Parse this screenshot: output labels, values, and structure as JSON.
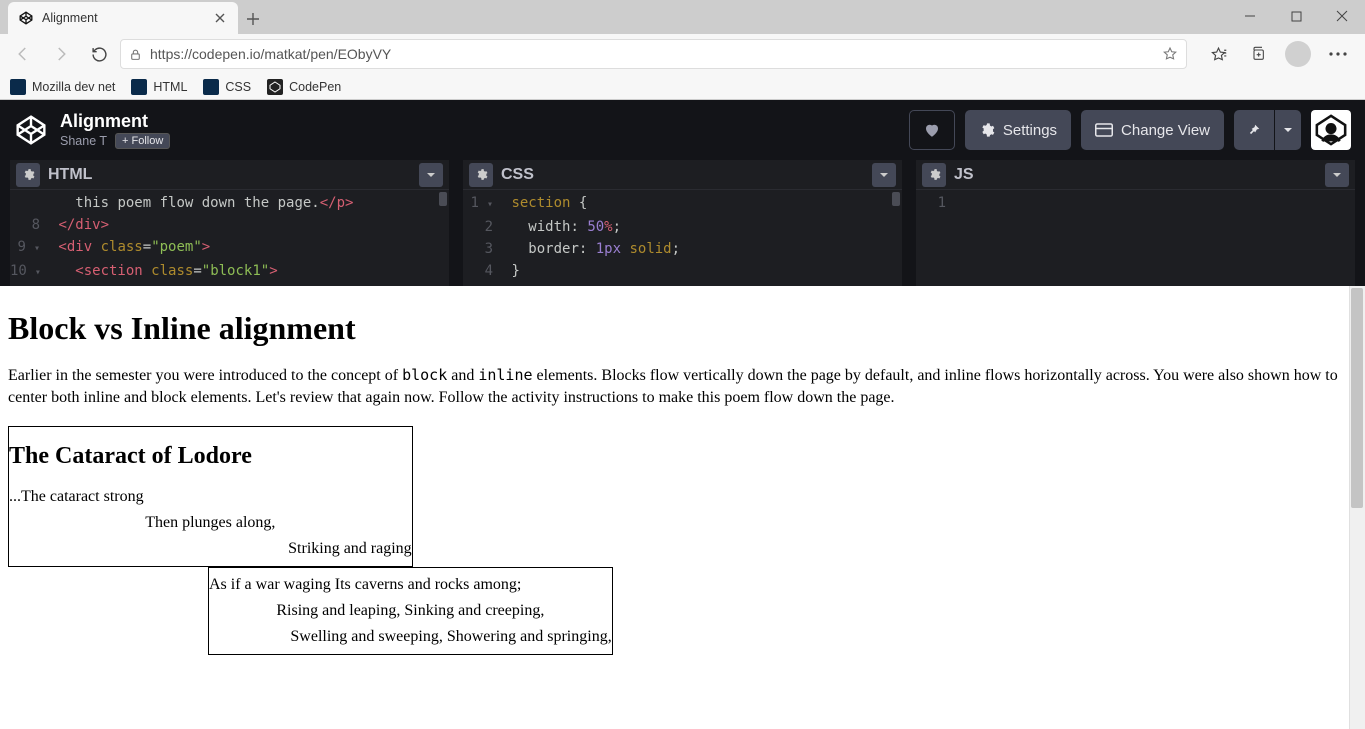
{
  "browser": {
    "tab_title": "Alignment",
    "url": "https://codepen.io/matkat/pen/EObyVY",
    "bookmarks": [
      "Mozilla dev net",
      "HTML",
      "CSS",
      "CodePen"
    ]
  },
  "codepen": {
    "title": "Alignment",
    "author": "Shane T",
    "follow_label": "+ Follow",
    "actions": {
      "settings": "Settings",
      "change_view": "Change View"
    },
    "panes": {
      "html": "HTML",
      "css": "CSS",
      "js": "JS"
    }
  },
  "code": {
    "html": {
      "lines": [
        {
          "n": "",
          "text_plain": "this poem flow down the page.",
          "closing": "</p>"
        },
        {
          "n": "8",
          "tag_close": "</div>"
        },
        {
          "n": "9",
          "tag_open": "div",
          "attr": "class",
          "val": "poem"
        },
        {
          "n": "10",
          "tag_open": "section",
          "attr": "class",
          "val": "block1"
        }
      ]
    },
    "css": {
      "lines": [
        {
          "n": "1",
          "sel": "section",
          "br": "{"
        },
        {
          "n": "2",
          "prop": "width",
          "val": "50",
          "unit": "%",
          "semi": ";"
        },
        {
          "n": "3",
          "prop": "border",
          "val": "1px",
          "kw": "solid",
          "semi": ";"
        },
        {
          "n": "4",
          "br": "}"
        }
      ]
    },
    "js": {
      "lines": [
        {
          "n": "1"
        }
      ]
    }
  },
  "preview": {
    "h1": "Block vs Inline alignment",
    "para_a": "Earlier in the semester you were introduced to the concept of ",
    "code1": "block",
    "para_b": " and ",
    "code2": "inline",
    "para_c": " elements. Blocks flow vertically down the page by default, and inline flows horizontally across. You were also shown how to center both inline and block elements. Let's review that again now. Follow the activity instructions to make this poem flow down the page.",
    "poem": {
      "title": "The Cataract of Lodore",
      "b1": {
        "l1": "...The cataract strong",
        "l2": "Then plunges along,",
        "l3": "Striking and raging"
      },
      "b2": {
        "l1": "As if a war waging Its caverns and rocks among;",
        "l2": "Rising and leaping, Sinking and creeping,",
        "l3": "Swelling and sweeping, Showering and springing,"
      }
    }
  }
}
